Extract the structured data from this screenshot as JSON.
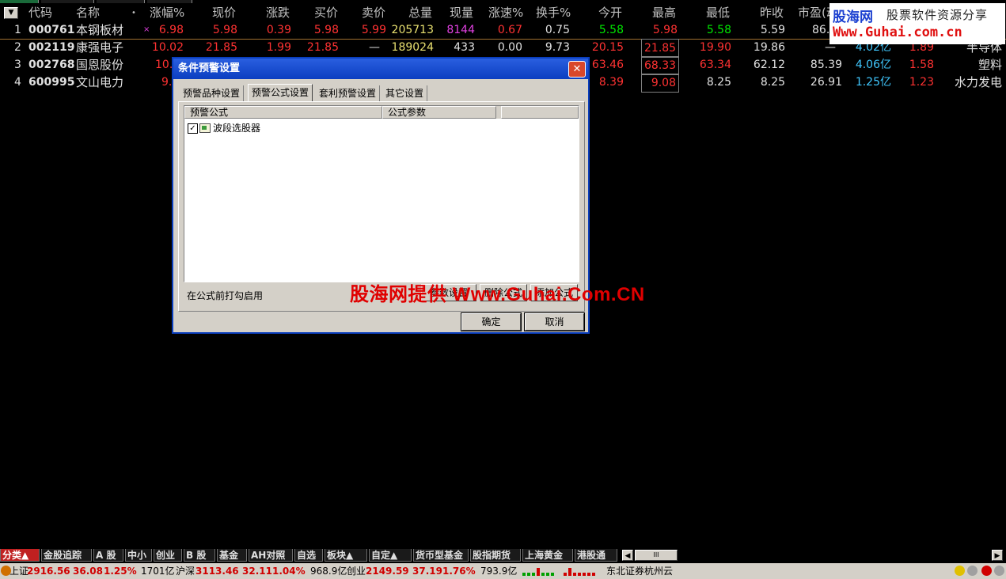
{
  "header": {
    "sort_arrow": "▼",
    "columns": [
      "代码",
      "名称",
      "•",
      "涨幅%",
      "现价",
      "涨跌",
      "买价",
      "卖价",
      "总量",
      "现量",
      "涨速%",
      "换手%",
      "今开",
      "最高",
      "最低",
      "昨收",
      "市盈(动)"
    ]
  },
  "rows": [
    {
      "idx": "1",
      "code": "000761",
      "name": "本钢板材",
      "flag": "×",
      "chg_pct": "6.98",
      "price": "5.98",
      "chg": "0.39",
      "bid": "5.98",
      "ask": "5.99",
      "vol": "205713",
      "cur_vol": "8144",
      "speed": "0.67",
      "turnover": "0.75",
      "open": "5.58",
      "high": "5.98",
      "low": "5.58",
      "prev": "5.59",
      "pe": "86.",
      "cap": "",
      "ratio": "",
      "industry": ""
    },
    {
      "idx": "2",
      "code": "002119",
      "name": "康强电子",
      "flag": "",
      "chg_pct": "10.02",
      "price": "21.85",
      "chg": "1.99",
      "bid": "21.85",
      "ask": "—",
      "vol": "189024",
      "cur_vol": "433",
      "speed": "0.00",
      "turnover": "9.73",
      "open": "20.15",
      "high": "21.85",
      "low": "19.90",
      "prev": "19.86",
      "pe": "—",
      "cap": "4.02亿",
      "ratio": "1.89",
      "industry": "半导体"
    },
    {
      "idx": "3",
      "code": "002768",
      "name": "国恩股份",
      "flag": "",
      "chg_pct": "10.",
      "price": "",
      "chg": "",
      "bid": "",
      "ask": "",
      "vol": "",
      "cur_vol": "",
      "speed": "",
      "turnover": "",
      "open": "63.46",
      "high": "68.33",
      "low": "63.34",
      "prev": "62.12",
      "pe": "85.39",
      "cap": "4.06亿",
      "ratio": "1.58",
      "industry": "塑料"
    },
    {
      "idx": "4",
      "code": "600995",
      "name": "文山电力",
      "flag": "",
      "chg_pct": "9.",
      "price": "",
      "chg": "",
      "bid": "",
      "ask": "",
      "vol": "",
      "cur_vol": "",
      "speed": "",
      "turnover": "",
      "open": "8.39",
      "high": "9.08",
      "low": "8.25",
      "prev": "8.25",
      "pe": "26.91",
      "cap": "1.25亿",
      "ratio": "1.23",
      "industry": "水力发电"
    }
  ],
  "watermark": {
    "logo_name": "股海网",
    "logo_tagline": "股票软件资源分享",
    "logo_url": "Www.Guhai.com.cn",
    "overlay": "股海网提供 Www.Guhai.Com.CN"
  },
  "dialog": {
    "title": "条件预警设置",
    "close": "✕",
    "tabs": [
      "预警品种设置",
      "预警公式设置",
      "套利预警设置",
      "其它设置"
    ],
    "active_tab": 1,
    "list_headers": [
      "预警公式",
      "公式参数",
      ""
    ],
    "formula": {
      "checked": "✓",
      "name": "波段选股器"
    },
    "hint": "在公式前打勾启用",
    "panel_buttons": [
      "参数设置",
      "删除公式",
      "添加公式"
    ],
    "ok": "确定",
    "cancel": "取消"
  },
  "categories": {
    "tabs": [
      "分类▲",
      "金股追踪",
      "A 股",
      "中小",
      "创业",
      "B 股",
      "基金",
      "AH对照",
      "自选",
      "板块▲",
      "自定▲",
      "货币型基金",
      "股指期货",
      "上海黄金",
      "港股通"
    ],
    "active": 0,
    "scroll_left": "◀",
    "scroll_right": "▶",
    "thumb": "III"
  },
  "status": {
    "sh_label": "上证",
    "sh_index": "2916.56",
    "sh_chg": "36.08",
    "sh_pct": "1.25%",
    "sh_amt": "1701亿",
    "sz_label": "沪深",
    "sz_index": "3113.46",
    "sz_chg": "32.11",
    "sz_pct": "1.04%",
    "sz_amt": "968.9亿",
    "cy_label": "创业",
    "cy_index": "2149.59",
    "cy_chg": "37.19",
    "cy_pct": "1.76%",
    "cy_amt": "793.9亿",
    "broker": "东北证券杭州云"
  },
  "colors": {
    "up": "#ff3232",
    "down": "#00e600",
    "accent": "#0a3ebd"
  }
}
